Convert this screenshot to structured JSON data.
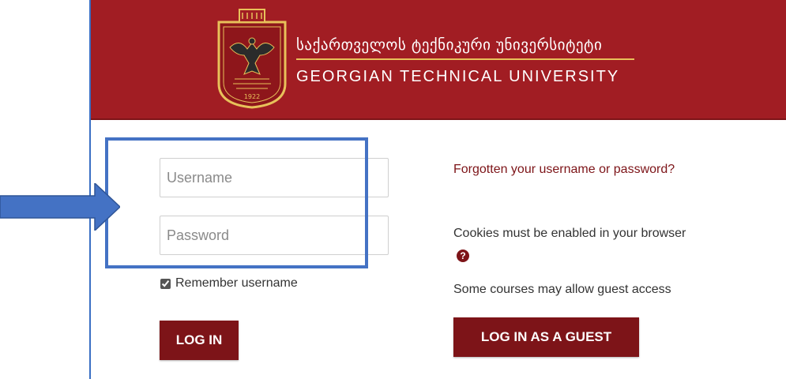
{
  "banner": {
    "name_ka": "საქართველოს ტექნიკური უნივერსიტეტი",
    "name_en": "GEORGIAN TECHNICAL UNIVERSITY",
    "crest_year": "1922",
    "bg_color": "#a11d23",
    "accent_color": "#e8c15a"
  },
  "login": {
    "username_placeholder": "Username",
    "username_value": "",
    "password_placeholder": "Password",
    "password_value": "",
    "remember_label": "Remember username",
    "remember_checked": true,
    "login_label": "LOG IN"
  },
  "help": {
    "forgot_link": "Forgotten your username or password?",
    "cookies_text": "Cookies must be enabled in your browser",
    "cookies_icon": "question-circle-icon",
    "guest_note": "Some courses may allow guest access",
    "guest_label": "LOG IN AS A GUEST"
  },
  "annotation": {
    "arrow_color": "#4472c4",
    "box_color": "#4472c4"
  }
}
